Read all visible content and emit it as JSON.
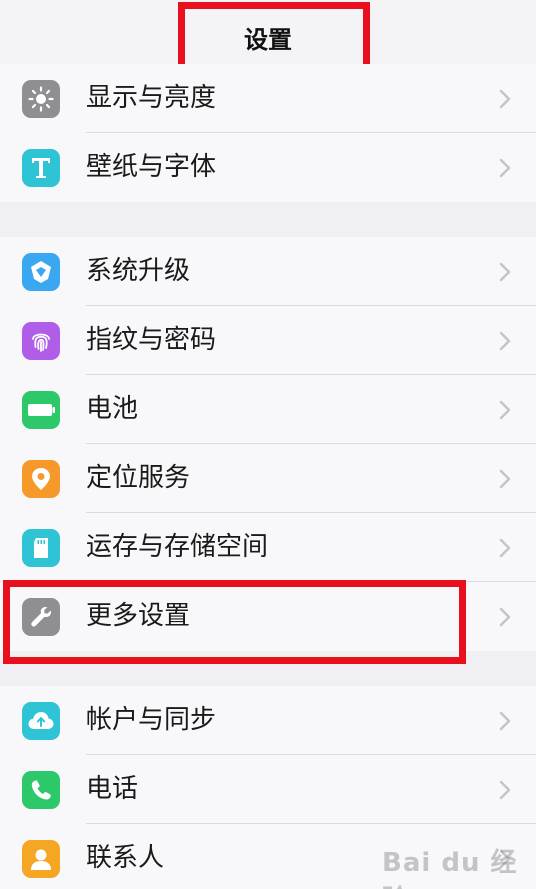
{
  "header": {
    "title": "设置"
  },
  "colors": {
    "highlight": "#e8101c"
  },
  "groups": [
    {
      "items": [
        {
          "id": "display",
          "label": "显示与亮度",
          "icon": "brightness-icon",
          "icon_bg": "#8e8e93"
        },
        {
          "id": "wallpaper",
          "label": "壁纸与字体",
          "icon": "text-t-icon",
          "icon_bg": "#2ec4d6"
        }
      ]
    },
    {
      "items": [
        {
          "id": "system-upgrade",
          "label": "系统升级",
          "icon": "upgrade-cube-icon",
          "icon_bg": "#3aa8f0"
        },
        {
          "id": "fingerprint",
          "label": "指纹与密码",
          "icon": "fingerprint-icon",
          "icon_bg": "#b05ee8"
        },
        {
          "id": "battery",
          "label": "电池",
          "icon": "battery-icon",
          "icon_bg": "#2cc86a"
        },
        {
          "id": "location",
          "label": "定位服务",
          "icon": "location-pin-icon",
          "icon_bg": "#f59a2a"
        },
        {
          "id": "storage",
          "label": "运存与存储空间",
          "icon": "sd-card-icon",
          "icon_bg": "#2ec4d6"
        },
        {
          "id": "more-settings",
          "label": "更多设置",
          "icon": "wrench-icon",
          "icon_bg": "#8e8e93"
        }
      ]
    },
    {
      "items": [
        {
          "id": "accounts",
          "label": "帐户与同步",
          "icon": "cloud-sync-icon",
          "icon_bg": "#2ec4d6"
        },
        {
          "id": "phone",
          "label": "电话",
          "icon": "phone-icon",
          "icon_bg": "#2cc86a"
        },
        {
          "id": "contacts",
          "label": "联系人",
          "icon": "contact-person-icon",
          "icon_bg": "#f5a623"
        }
      ]
    }
  ],
  "watermark": {
    "text": "Bai du 经验"
  }
}
